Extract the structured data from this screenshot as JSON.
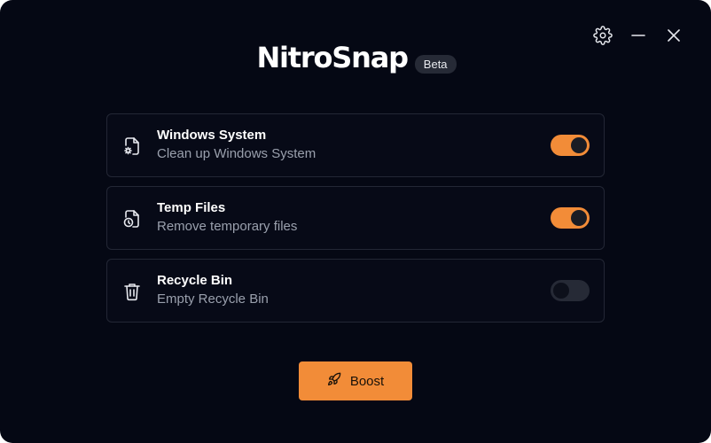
{
  "app": {
    "title": "NitroSnap",
    "badge": "Beta"
  },
  "titlebar": {
    "icons": [
      "gear-icon",
      "minimize-icon",
      "close-icon"
    ]
  },
  "options": [
    {
      "title": "Windows System",
      "subtitle": "Clean up Windows System",
      "icon": "file-gear-icon",
      "enabled": true
    },
    {
      "title": "Temp Files",
      "subtitle": "Remove temporary files",
      "icon": "file-clock-icon",
      "enabled": true
    },
    {
      "title": "Recycle Bin",
      "subtitle": "Empty Recycle Bin",
      "icon": "trash-icon",
      "enabled": false
    }
  ],
  "boost": {
    "label": "Boost",
    "icon": "rocket-icon"
  },
  "colors": {
    "background": "#050814",
    "accent": "#f28c38",
    "card_border": "#232735",
    "muted_text": "#9aa0ad"
  }
}
